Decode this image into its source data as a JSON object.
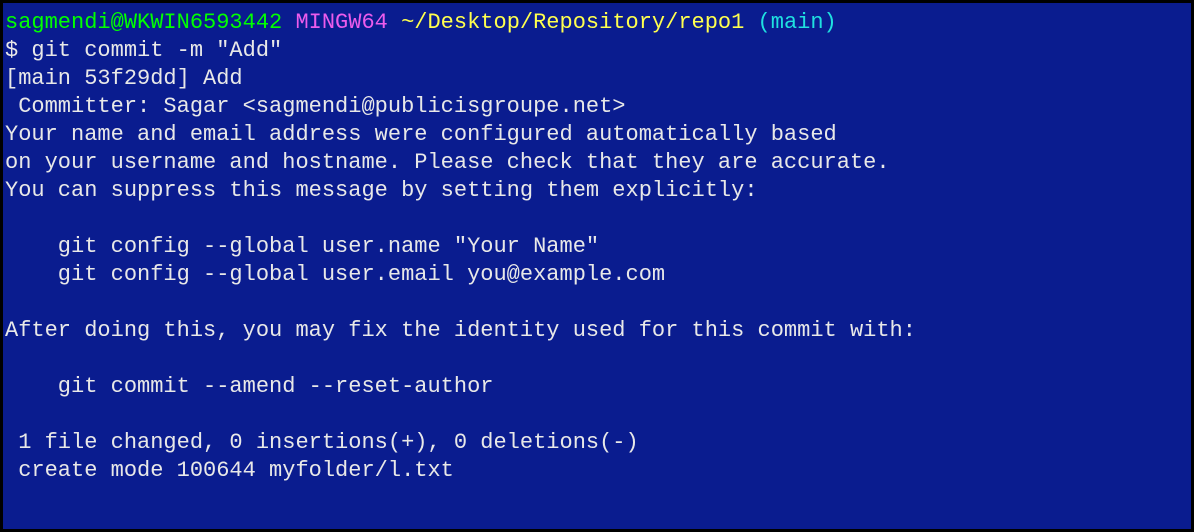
{
  "prompt": {
    "user_host": "sagmendi@WKWIN6593442",
    "env": "MINGW64",
    "path": "~/Desktop/Repository/repo1",
    "branch": "(main)"
  },
  "command": "$ git commit -m \"Add\"",
  "output": {
    "l1": "[main 53f29dd] Add",
    "l2": " Committer: Sagar <sagmendi@publicisgroupe.net>",
    "l3": "Your name and email address were configured automatically based",
    "l4": "on your username and hostname. Please check that they are accurate.",
    "l5": "You can suppress this message by setting them explicitly:",
    "l6": "",
    "l7": "    git config --global user.name \"Your Name\"",
    "l8": "    git config --global user.email you@example.com",
    "l9": "",
    "l10": "After doing this, you may fix the identity used for this commit with:",
    "l11": "",
    "l12": "    git commit --amend --reset-author",
    "l13": "",
    "l14": " 1 file changed, 0 insertions(+), 0 deletions(-)",
    "l15": " create mode 100644 myfolder/l.txt"
  }
}
